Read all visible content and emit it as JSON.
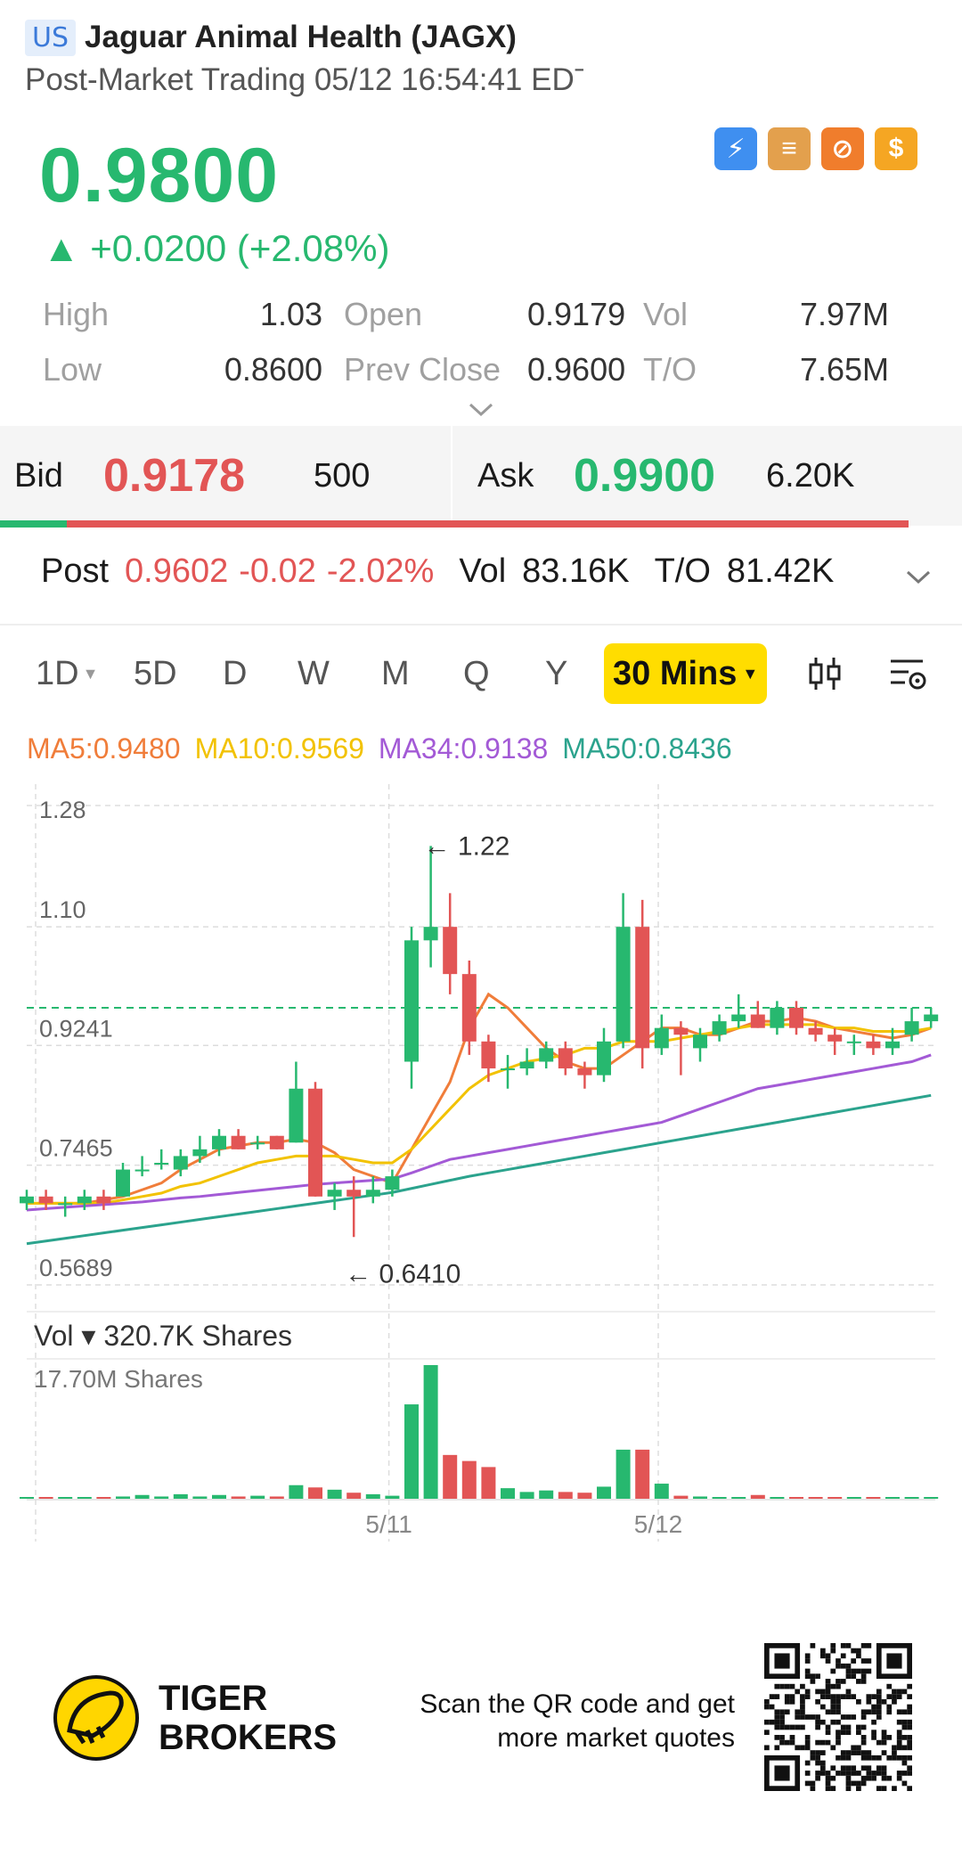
{
  "header": {
    "market": "US",
    "title": "Jaguar Animal Health (JAGX)",
    "subtitle": "Post-Market Trading 05/12 16:54:41 EDˉ"
  },
  "quote": {
    "price": "0.9800",
    "change": "▲ +0.0200 (+2.08%)",
    "badges": [
      {
        "icon": "lightning-1-icon",
        "color": "#3f8ff0",
        "glyph": "⚡"
      },
      {
        "icon": "layers-a-icon",
        "color": "#e3a04d",
        "glyph": "≡"
      },
      {
        "icon": "no-shorting-icon",
        "color": "#f07d2c",
        "glyph": "⊘"
      },
      {
        "icon": "dollar-icon",
        "color": "#f5a623",
        "glyph": "$"
      }
    ]
  },
  "stats": {
    "high_label": "High",
    "high": "1.03",
    "open_label": "Open",
    "open": "0.9179",
    "vol_label": "Vol",
    "vol": "7.97M",
    "low_label": "Low",
    "low": "0.8600",
    "prev_label": "Prev Close",
    "prev": "0.9600",
    "to_label": "T/O",
    "to": "7.65M"
  },
  "bid_ask": {
    "bid_label": "Bid",
    "bid": "0.9178",
    "bid_size": "500",
    "ask_label": "Ask",
    "ask": "0.9900",
    "ask_size": "6.20K",
    "bid_share": 0.074
  },
  "post": {
    "label": "Post",
    "price": "0.9602",
    "change": "-0.02",
    "pct": "-2.02%",
    "vol_label": "Vol",
    "vol": "83.16K",
    "to_label": "T/O",
    "to": "81.42K"
  },
  "tabs": [
    "1D",
    "5D",
    "D",
    "W",
    "M",
    "Q",
    "Y",
    "30 Mins"
  ],
  "selected_tab": "30 Mins",
  "ma_legend": [
    {
      "label": "MA5:0.9480",
      "color": "#f07d3a"
    },
    {
      "label": "MA10:0.9569",
      "color": "#f2c200"
    },
    {
      "label": "MA34:0.9138",
      "color": "#a35ad6"
    },
    {
      "label": "MA50:0.8436",
      "color": "#2ba38d"
    }
  ],
  "volume": {
    "label": "Vol ▾ 320.7K Shares",
    "max_label": "17.70M Shares"
  },
  "chart_data": {
    "type": "candlestick",
    "y_ticks": [
      "1.28",
      "1.10",
      "0.9241",
      "0.7465",
      "0.5689"
    ],
    "ylim": [
      0.5689,
      1.28
    ],
    "x_ticks": [
      "5/11",
      "5/12"
    ],
    "annotations": [
      {
        "text": "← 1.22",
        "value": 1.22
      },
      {
        "text": "← 0.6410",
        "value": 0.641
      }
    ],
    "last_price": 0.98,
    "candles": [
      {
        "o": 0.69,
        "c": 0.7,
        "h": 0.71,
        "l": 0.68
      },
      {
        "o": 0.7,
        "c": 0.69,
        "h": 0.71,
        "l": 0.68
      },
      {
        "o": 0.69,
        "c": 0.69,
        "h": 0.7,
        "l": 0.67
      },
      {
        "o": 0.69,
        "c": 0.7,
        "h": 0.71,
        "l": 0.68
      },
      {
        "o": 0.7,
        "c": 0.69,
        "h": 0.71,
        "l": 0.68
      },
      {
        "o": 0.7,
        "c": 0.74,
        "h": 0.75,
        "l": 0.7
      },
      {
        "o": 0.74,
        "c": 0.74,
        "h": 0.76,
        "l": 0.73
      },
      {
        "o": 0.75,
        "c": 0.75,
        "h": 0.77,
        "l": 0.74
      },
      {
        "o": 0.74,
        "c": 0.76,
        "h": 0.77,
        "l": 0.73
      },
      {
        "o": 0.76,
        "c": 0.77,
        "h": 0.79,
        "l": 0.75
      },
      {
        "o": 0.77,
        "c": 0.79,
        "h": 0.8,
        "l": 0.76
      },
      {
        "o": 0.79,
        "c": 0.77,
        "h": 0.8,
        "l": 0.77
      },
      {
        "o": 0.78,
        "c": 0.78,
        "h": 0.79,
        "l": 0.77
      },
      {
        "o": 0.79,
        "c": 0.77,
        "h": 0.79,
        "l": 0.77
      },
      {
        "o": 0.78,
        "c": 0.86,
        "h": 0.9,
        "l": 0.78
      },
      {
        "o": 0.86,
        "c": 0.7,
        "h": 0.87,
        "l": 0.7
      },
      {
        "o": 0.7,
        "c": 0.71,
        "h": 0.72,
        "l": 0.68
      },
      {
        "o": 0.71,
        "c": 0.7,
        "h": 0.73,
        "l": 0.64
      },
      {
        "o": 0.7,
        "c": 0.71,
        "h": 0.73,
        "l": 0.69
      },
      {
        "o": 0.71,
        "c": 0.73,
        "h": 0.74,
        "l": 0.7
      },
      {
        "o": 0.9,
        "c": 1.08,
        "h": 1.1,
        "l": 0.86
      },
      {
        "o": 1.08,
        "c": 1.1,
        "h": 1.22,
        "l": 1.04
      },
      {
        "o": 1.1,
        "c": 1.03,
        "h": 1.15,
        "l": 1.0
      },
      {
        "o": 1.03,
        "c": 0.93,
        "h": 1.05,
        "l": 0.91
      },
      {
        "o": 0.93,
        "c": 0.89,
        "h": 0.94,
        "l": 0.87
      },
      {
        "o": 0.89,
        "c": 0.89,
        "h": 0.91,
        "l": 0.86
      },
      {
        "o": 0.89,
        "c": 0.9,
        "h": 0.92,
        "l": 0.88
      },
      {
        "o": 0.9,
        "c": 0.92,
        "h": 0.93,
        "l": 0.89
      },
      {
        "o": 0.92,
        "c": 0.89,
        "h": 0.93,
        "l": 0.88
      },
      {
        "o": 0.89,
        "c": 0.88,
        "h": 0.9,
        "l": 0.86
      },
      {
        "o": 0.88,
        "c": 0.93,
        "h": 0.95,
        "l": 0.87
      },
      {
        "o": 0.93,
        "c": 1.1,
        "h": 1.15,
        "l": 0.92
      },
      {
        "o": 1.1,
        "c": 0.92,
        "h": 1.14,
        "l": 0.89
      },
      {
        "o": 0.92,
        "c": 0.95,
        "h": 0.97,
        "l": 0.91
      },
      {
        "o": 0.95,
        "c": 0.94,
        "h": 0.96,
        "l": 0.88
      },
      {
        "o": 0.92,
        "c": 0.94,
        "h": 0.95,
        "l": 0.9
      },
      {
        "o": 0.94,
        "c": 0.96,
        "h": 0.97,
        "l": 0.93
      },
      {
        "o": 0.96,
        "c": 0.97,
        "h": 1.0,
        "l": 0.95
      },
      {
        "o": 0.97,
        "c": 0.95,
        "h": 0.99,
        "l": 0.95
      },
      {
        "o": 0.95,
        "c": 0.98,
        "h": 0.99,
        "l": 0.94
      },
      {
        "o": 0.98,
        "c": 0.95,
        "h": 0.99,
        "l": 0.94
      },
      {
        "o": 0.95,
        "c": 0.94,
        "h": 0.96,
        "l": 0.93
      },
      {
        "o": 0.94,
        "c": 0.93,
        "h": 0.95,
        "l": 0.91
      },
      {
        "o": 0.93,
        "c": 0.93,
        "h": 0.94,
        "l": 0.91
      },
      {
        "o": 0.93,
        "c": 0.92,
        "h": 0.94,
        "l": 0.91
      },
      {
        "o": 0.92,
        "c": 0.93,
        "h": 0.95,
        "l": 0.91
      },
      {
        "o": 0.94,
        "c": 0.96,
        "h": 0.98,
        "l": 0.93
      },
      {
        "o": 0.96,
        "c": 0.97,
        "h": 0.98,
        "l": 0.95
      }
    ],
    "ma_series": [
      {
        "name": "MA5",
        "color": "#f07d3a",
        "values": [
          0.69,
          0.69,
          0.69,
          0.69,
          0.695,
          0.7,
          0.71,
          0.72,
          0.74,
          0.755,
          0.77,
          0.775,
          0.78,
          0.78,
          0.785,
          0.78,
          0.765,
          0.74,
          0.73,
          0.72,
          0.77,
          0.82,
          0.87,
          0.95,
          1.0,
          0.98,
          0.95,
          0.92,
          0.9,
          0.89,
          0.89,
          0.91,
          0.93,
          0.95,
          0.95,
          0.94,
          0.94,
          0.95,
          0.96,
          0.96,
          0.965,
          0.96,
          0.95,
          0.945,
          0.94,
          0.935,
          0.94,
          0.95
        ]
      },
      {
        "name": "MA10",
        "color": "#f2c200",
        "values": [
          0.69,
          0.69,
          0.69,
          0.69,
          0.69,
          0.695,
          0.7,
          0.705,
          0.715,
          0.72,
          0.73,
          0.74,
          0.75,
          0.755,
          0.76,
          0.76,
          0.76,
          0.755,
          0.75,
          0.75,
          0.77,
          0.8,
          0.83,
          0.86,
          0.88,
          0.89,
          0.9,
          0.905,
          0.91,
          0.92,
          0.92,
          0.93,
          0.93,
          0.93,
          0.935,
          0.94,
          0.945,
          0.95,
          0.955,
          0.955,
          0.955,
          0.955,
          0.95,
          0.95,
          0.945,
          0.945,
          0.945,
          0.95
        ]
      },
      {
        "name": "MA34",
        "color": "#a35ad6",
        "values": [
          0.68,
          0.682,
          0.684,
          0.686,
          0.688,
          0.69,
          0.692,
          0.695,
          0.698,
          0.7,
          0.703,
          0.706,
          0.709,
          0.712,
          0.715,
          0.718,
          0.72,
          0.722,
          0.724,
          0.726,
          0.735,
          0.745,
          0.755,
          0.76,
          0.765,
          0.77,
          0.775,
          0.78,
          0.785,
          0.79,
          0.795,
          0.8,
          0.805,
          0.81,
          0.82,
          0.83,
          0.84,
          0.85,
          0.86,
          0.865,
          0.87,
          0.875,
          0.88,
          0.885,
          0.89,
          0.895,
          0.9,
          0.91
        ]
      },
      {
        "name": "MA50",
        "color": "#2ba38d",
        "values": [
          0.63,
          0.634,
          0.638,
          0.642,
          0.646,
          0.65,
          0.654,
          0.658,
          0.662,
          0.666,
          0.67,
          0.674,
          0.678,
          0.682,
          0.686,
          0.69,
          0.694,
          0.698,
          0.702,
          0.706,
          0.712,
          0.718,
          0.724,
          0.73,
          0.735,
          0.74,
          0.745,
          0.75,
          0.755,
          0.76,
          0.765,
          0.77,
          0.775,
          0.78,
          0.785,
          0.79,
          0.795,
          0.8,
          0.805,
          0.81,
          0.815,
          0.82,
          0.825,
          0.83,
          0.835,
          0.84,
          0.845,
          0.85
        ]
      }
    ],
    "volumes": [
      0.1,
      0.1,
      0.1,
      0.1,
      0.2,
      0.3,
      0.5,
      0.3,
      0.6,
      0.3,
      0.5,
      0.3,
      0.4,
      0.3,
      1.8,
      1.5,
      1.2,
      0.8,
      0.6,
      0.4,
      12.5,
      17.7,
      5.8,
      5.0,
      4.2,
      1.4,
      0.9,
      1.1,
      0.9,
      0.8,
      1.6,
      6.5,
      6.5,
      2.0,
      0.4,
      0.3,
      0.2,
      0.2,
      0.5,
      0.2,
      0.2,
      0.1,
      0.1,
      0.1,
      0.1,
      0.2,
      0.2,
      0.2
    ]
  },
  "footer": {
    "brand_line1": "TIGER",
    "brand_line2": "BROKERS",
    "scan_line1": "Scan the QR code and get",
    "scan_line2": "more market quotes"
  }
}
